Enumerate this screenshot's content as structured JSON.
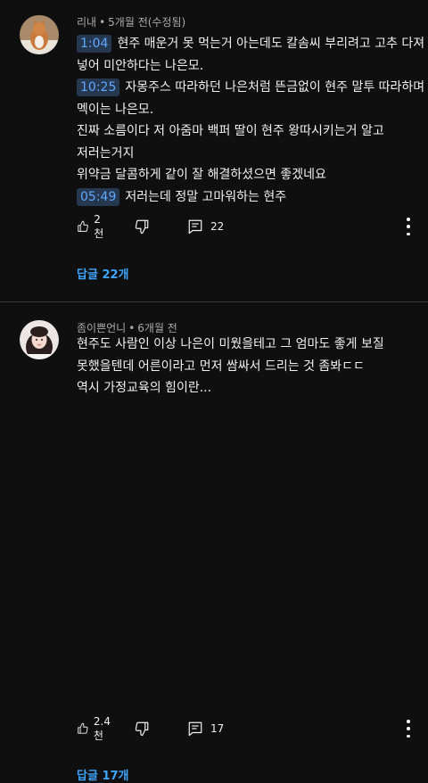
{
  "comments": [
    {
      "author": "리내",
      "time": "5개월 전(수정됨)",
      "lines": [
        {
          "ts": "1:04",
          "text": "현주 매운거 못 먹는거 아는데도 칼솜씨 부리려고 고추 다져"
        },
        {
          "ts": "",
          "text": "넣어 미안하다는 나은모."
        },
        {
          "ts": "10:25",
          "text": "자몽주스 따라하던 나은처럼 뜬금없이 현주 말투 따라하며"
        },
        {
          "ts": "",
          "text": "멕이는 나은모."
        },
        {
          "ts": "",
          "text": "진짜 소름이다 저 아줌마 백퍼 딸이 현주 왕따시키는거 알고"
        },
        {
          "ts": "",
          "text": "저러는거지"
        },
        {
          "ts": "",
          "text": "위약금 달콤하게 같이 잘 해결하셨으면 좋겠네요"
        },
        {
          "ts": "05:49",
          "text": "저러는데 정말 고마워하는 현주"
        }
      ],
      "likes": "2천",
      "reply_count": "22",
      "replies_label": "답글 22개"
    },
    {
      "author": "좀이쁜언니",
      "time": "6개월 전",
      "lines": [
        {
          "ts": "",
          "text": "현주도 사람인 이상 나은이 미웠을테고 그 엄마도 좋게 보질"
        },
        {
          "ts": "",
          "text": "못했을텐데 어른이라고 먼저 쌈싸서 드리는 것 좀봐ㄷㄷ"
        },
        {
          "ts": "",
          "text": "역시 가정교육의 힘이란..."
        }
      ],
      "likes": "2.4천",
      "reply_count": "17",
      "replies_label": "답글 17개"
    }
  ],
  "separator": "•",
  "icons": {
    "like": "thumbs-up-icon",
    "dislike": "thumbs-down-icon",
    "reply": "reply-comment-icon",
    "more": "more-vertical-icon"
  },
  "colors": {
    "background": "#0f0f0f",
    "text": "#f1f1f1",
    "meta": "#aaaaaa",
    "link": "#3ea6ff",
    "timestamp_bg": "#263850",
    "timestamp_text": "#5ea8ff"
  }
}
